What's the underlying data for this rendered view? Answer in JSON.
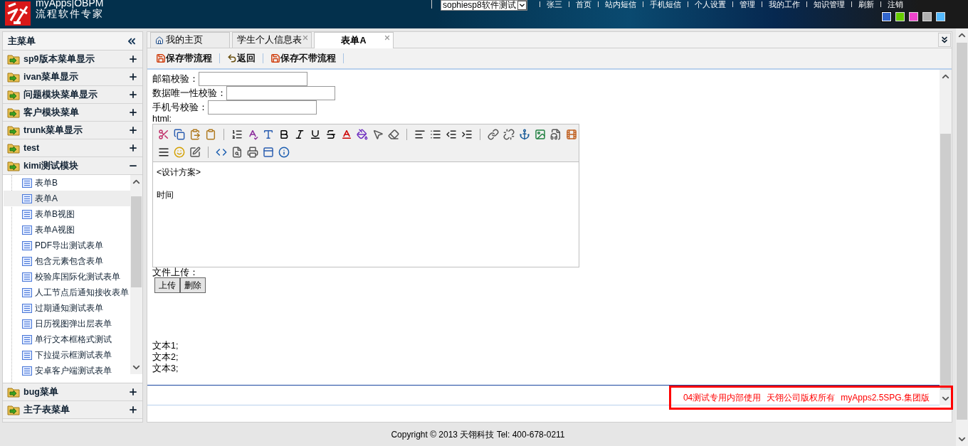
{
  "header": {
    "brand": "myApps|OBPM",
    "slogan": "流程软件专家",
    "user_select": "sophiesp8软件测试",
    "links": [
      "张三",
      "首页",
      "站内短信",
      "手机短信",
      "个人设置",
      "管理",
      "我的工作",
      "知识管理",
      "刷新",
      "注销"
    ],
    "themes": [
      {
        "color": "#3366cc",
        "selected": true
      },
      {
        "color": "#66cc00",
        "selected": false
      },
      {
        "color": "#ee44cc",
        "selected": false
      },
      {
        "color": "#b0b0b0",
        "selected": false
      },
      {
        "color": "#55bbff",
        "selected": false
      }
    ]
  },
  "sidebar": {
    "title": "主菜单",
    "menus": [
      {
        "label": "sp9版本菜单显示",
        "expanded": false
      },
      {
        "label": "ivan菜单显示",
        "expanded": false
      },
      {
        "label": "问题模块菜单显示",
        "expanded": false
      },
      {
        "label": "客户模块菜单",
        "expanded": false
      },
      {
        "label": "trunk菜单显示",
        "expanded": false
      },
      {
        "label": "test",
        "expanded": false
      },
      {
        "label": "kimi测试模块",
        "expanded": true,
        "children": [
          {
            "label": "表单B",
            "selected": false
          },
          {
            "label": "表单A",
            "selected": true
          },
          {
            "label": "表单B视图",
            "selected": false
          },
          {
            "label": "表单A视图",
            "selected": false
          },
          {
            "label": "PDF导出测试表单",
            "selected": false
          },
          {
            "label": "包含元素包含表单",
            "selected": false
          },
          {
            "label": "校验库国际化测试表单",
            "selected": false
          },
          {
            "label": "人工节点后通知接收表单",
            "selected": false
          },
          {
            "label": "过期通知测试表单",
            "selected": false
          },
          {
            "label": "日历视图弹出层表单",
            "selected": false
          },
          {
            "label": "单行文本框格式测试",
            "selected": false
          },
          {
            "label": "下拉提示框测试表单",
            "selected": false
          },
          {
            "label": "安卓客户端测试表单",
            "selected": false
          }
        ]
      },
      {
        "label": "bug菜单",
        "expanded": false
      },
      {
        "label": "主子表菜单",
        "expanded": false
      }
    ]
  },
  "tabs": [
    {
      "label": "我的主页",
      "kind": "home",
      "selected": false
    },
    {
      "label": "学生个人信息表",
      "kind": "closable",
      "selected": false
    },
    {
      "label": "表单A",
      "kind": "closable",
      "selected": true
    }
  ],
  "toolbar": [
    {
      "label": "保存带流程",
      "kind": "save"
    },
    {
      "label": "返回",
      "kind": "back"
    },
    {
      "label": "保存不带流程",
      "kind": "save"
    }
  ],
  "form": {
    "fields": [
      {
        "label": "邮箱校验："
      },
      {
        "label": "数据唯一性校验："
      },
      {
        "label": "手机号校验："
      }
    ],
    "editor_label": "html:",
    "editor_lines": [
      "<设计方案>",
      "时间"
    ],
    "upload_label": "文件上传：",
    "upload_buttons": [
      "上传",
      "删除"
    ],
    "texts": [
      "文本1;",
      "文本2;",
      "文本3;"
    ]
  },
  "footer_notice": [
    "04测试专用内部使用",
    "天翎公司版权所有",
    "myApps2.5SPG.集团版"
  ],
  "copyright": "Copyright © 2013 天翎科技  Tel: 400-678-0211"
}
